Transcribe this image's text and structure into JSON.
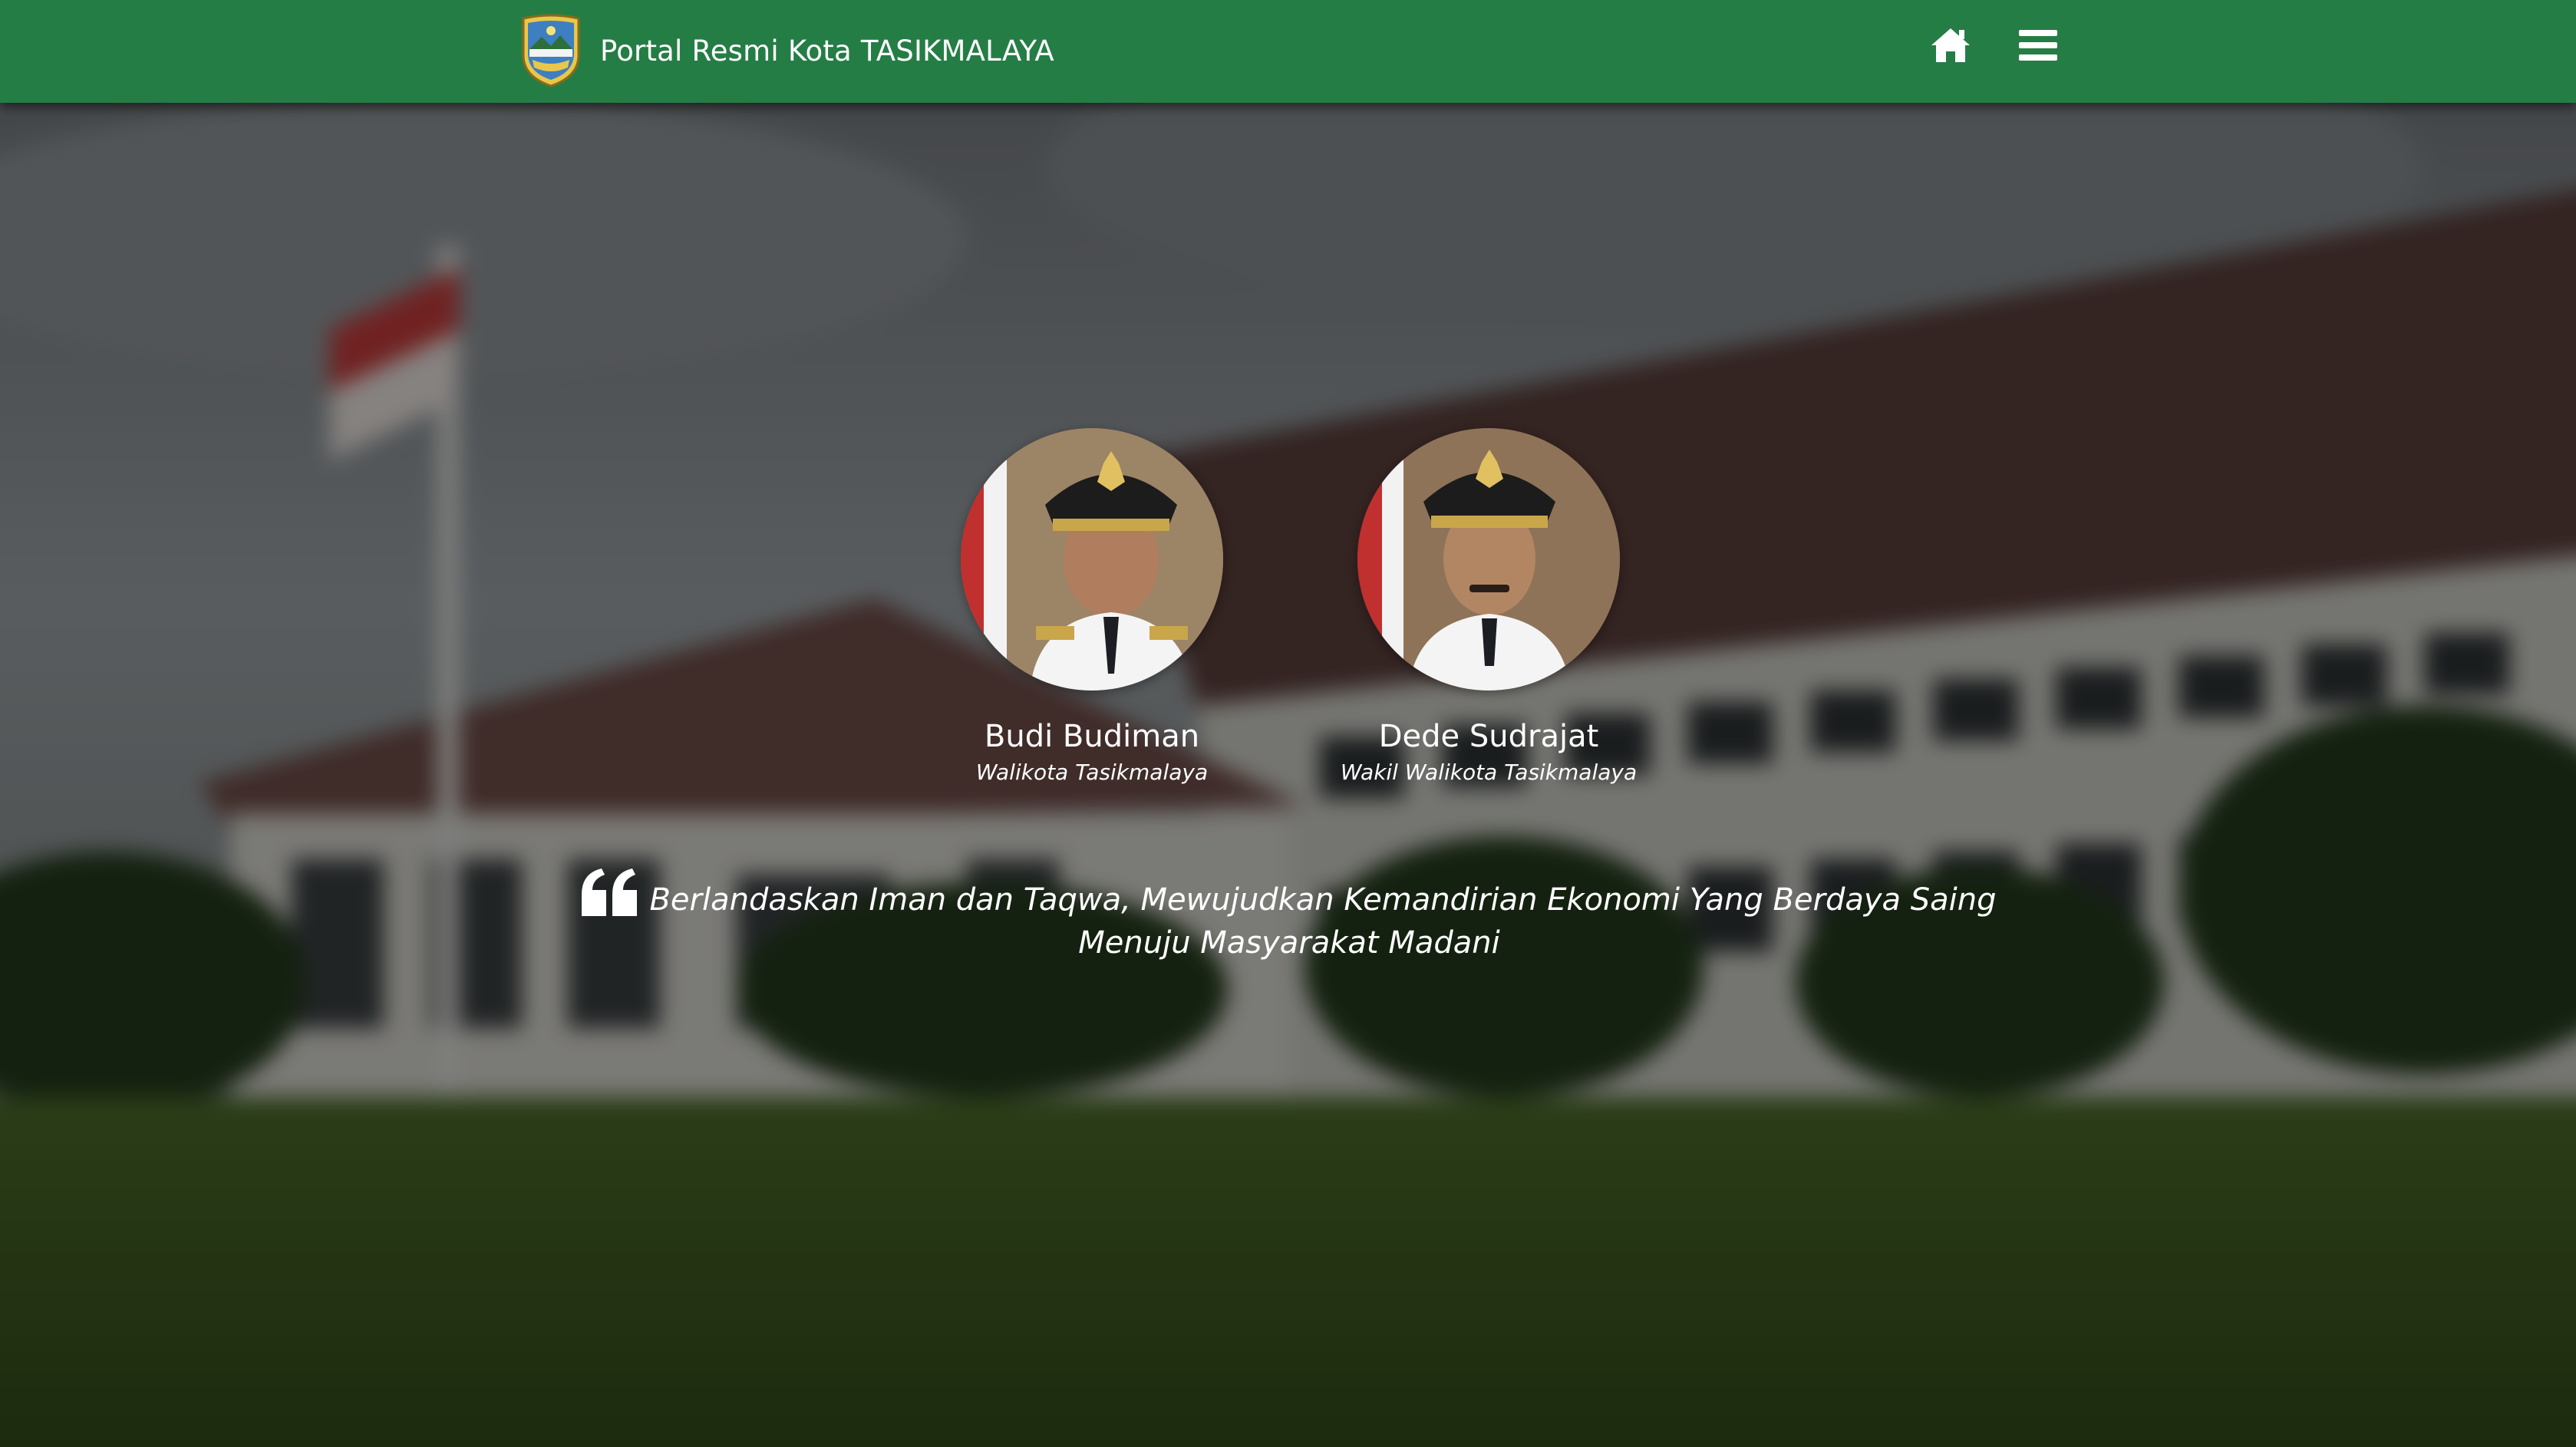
{
  "header": {
    "site_title": "Portal Resmi Kota TASIKMALAYA",
    "logo_icon": "city-emblem-icon",
    "home_icon": "home-icon",
    "menu_icon": "hamburger-menu-icon",
    "background_color": "#257d46"
  },
  "officials": [
    {
      "name": "Budi Budiman",
      "title": "Walikota Tasikmalaya"
    },
    {
      "name": "Dede Sudrajat",
      "title": "Wakil Walikota Tasikmalaya"
    }
  ],
  "motto": {
    "quote_icon": "quote-left-icon",
    "text": "Berlandaskan Iman dan Taqwa, Mewujudkan Kemandirian Ekonomi Yang Berdaya Saing Menuju Masyarakat Madani"
  }
}
